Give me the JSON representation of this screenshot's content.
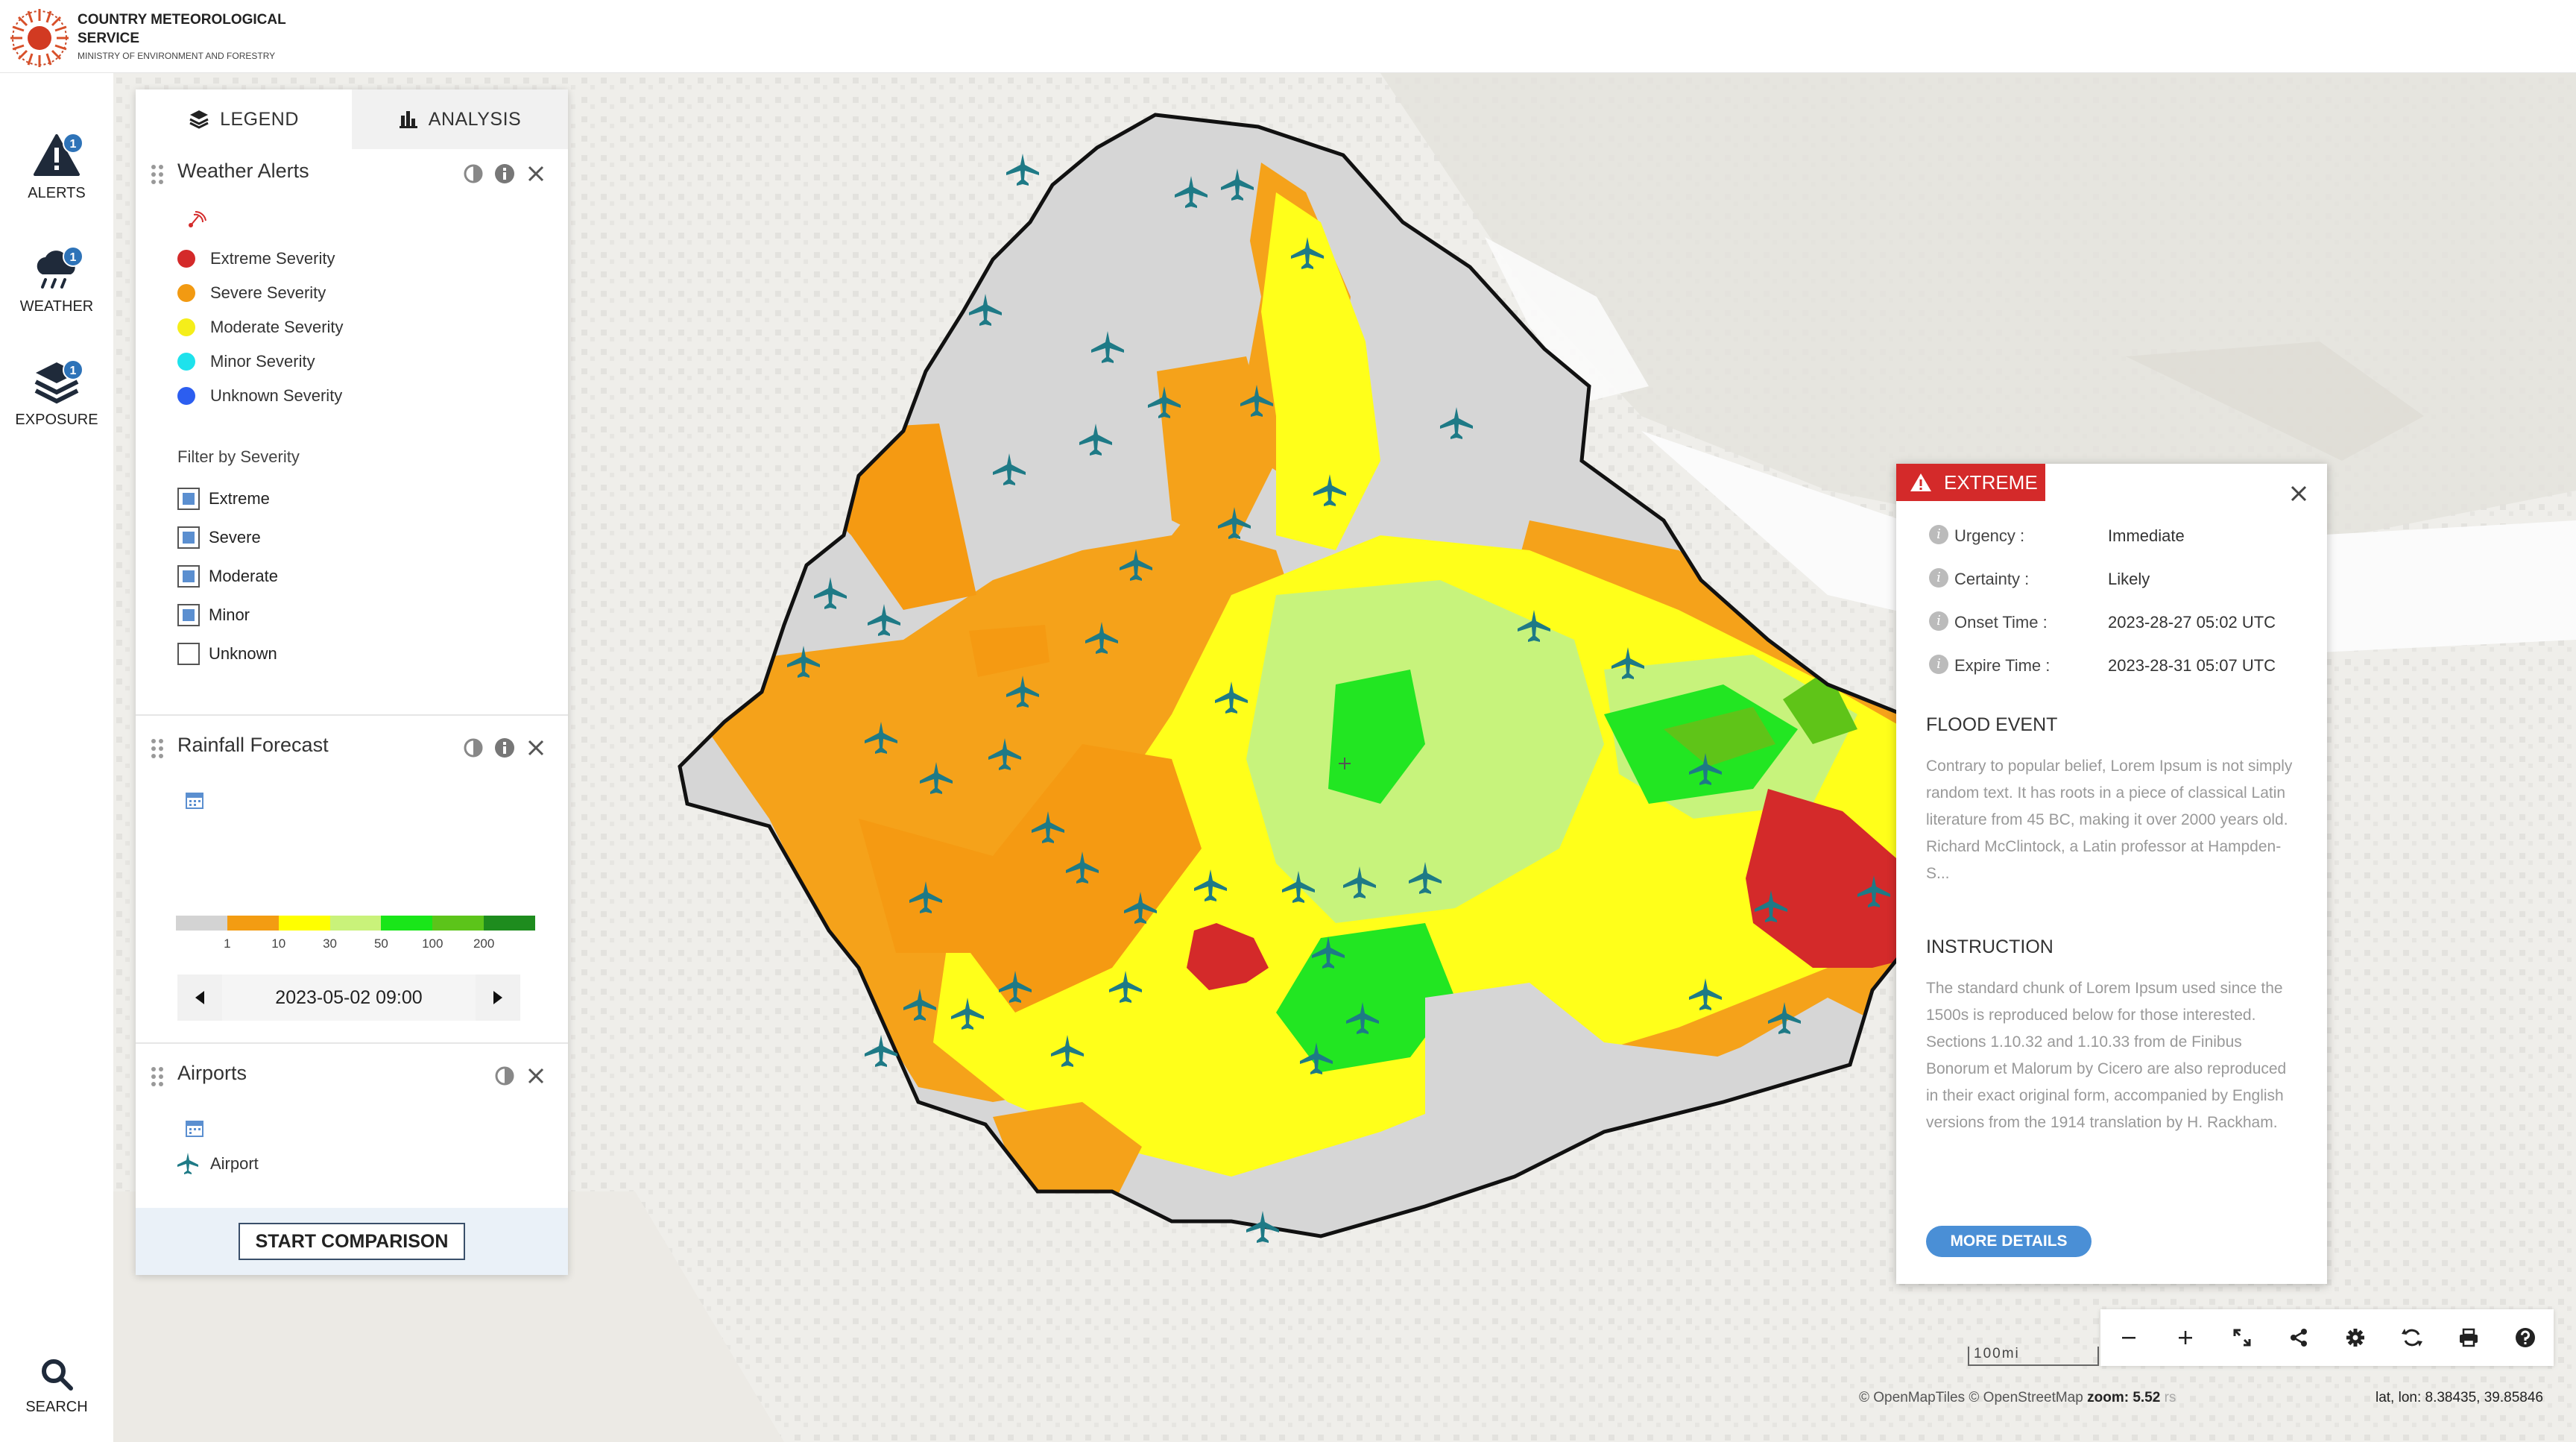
{
  "header": {
    "org_name": "Country Meteorological Service",
    "org_sub": "Ministry of Environment and Forestry"
  },
  "rail": {
    "alerts": {
      "label": "Alerts",
      "badge": "1"
    },
    "weather": {
      "label": "Weather",
      "badge": "1"
    },
    "exposure": {
      "label": "Exposure",
      "badge": "1"
    },
    "search": {
      "label": "Search"
    }
  },
  "panel": {
    "tabs": {
      "legend": "Legend",
      "analysis": "Analysis"
    },
    "weather_alerts": {
      "title": "Weather Alerts",
      "legend": [
        {
          "label": "Extreme Severity",
          "color": "#d42a2a"
        },
        {
          "label": "Severe Severity",
          "color": "#f29a12"
        },
        {
          "label": "Moderate Severity",
          "color": "#f5ee1a"
        },
        {
          "label": "Minor Severity",
          "color": "#1ee2ec"
        },
        {
          "label": "Unknown Severity",
          "color": "#2c5ef0"
        }
      ],
      "filter_title": "Filter by Severity",
      "filters": [
        {
          "label": "Extreme",
          "checked": true
        },
        {
          "label": "Severe",
          "checked": true
        },
        {
          "label": "Moderate",
          "checked": true
        },
        {
          "label": "Minor",
          "checked": true
        },
        {
          "label": "Unknown",
          "checked": false
        }
      ]
    },
    "rainfall": {
      "title": "Rainfall Forecast",
      "ramp_colors": [
        "#d3d3d3",
        "#f39c12",
        "#ffff00",
        "#c9f27a",
        "#19e619",
        "#5cc41a",
        "#1e8c1e"
      ],
      "ticks": [
        "1",
        "10",
        "30",
        "50",
        "100",
        "200"
      ],
      "date": "2023-05-02 09:00"
    },
    "airports": {
      "title": "Airports",
      "legend_label": "Airport"
    },
    "compare_button": "Start Comparison"
  },
  "popup": {
    "severity": "Extreme",
    "fields": [
      {
        "key": "Urgency :",
        "value": "Immediate"
      },
      {
        "key": "Certainty :",
        "value": "Likely"
      },
      {
        "key": "Onset Time :",
        "value": "2023-28-27 05:02 UTC"
      },
      {
        "key": "Expire Time :",
        "value": "2023-28-31 05:07 UTC"
      }
    ],
    "event_title": "FLOOD EVENT",
    "event_text": "Contrary to popular belief, Lorem Ipsum is not simply random text. It has roots in a piece of classical Latin literature from 45 BC, making it over 2000 years old. Richard McClintock, a Latin professor at Hampden-S...",
    "instruction_title": "INSTRUCTION",
    "instruction_text": "The standard chunk of Lorem Ipsum used since the 1500s is reproduced below for those interested. Sections 1.10.32 and 1.10.33 from de Finibus Bonorum et Malorum by Cicero are also reproduced in their exact original form, accompanied by English versions from the 1914 translation by H. Rackham.",
    "more_button": "More Details"
  },
  "map": {
    "scale_label": "100mi",
    "attribution": "© OpenMapTiles  © OpenStreetMap",
    "zoom_label": "zoom: 5.52",
    "attribution_tail": "rs",
    "coords": "lat, lon: 8.38435, 39.85846"
  }
}
